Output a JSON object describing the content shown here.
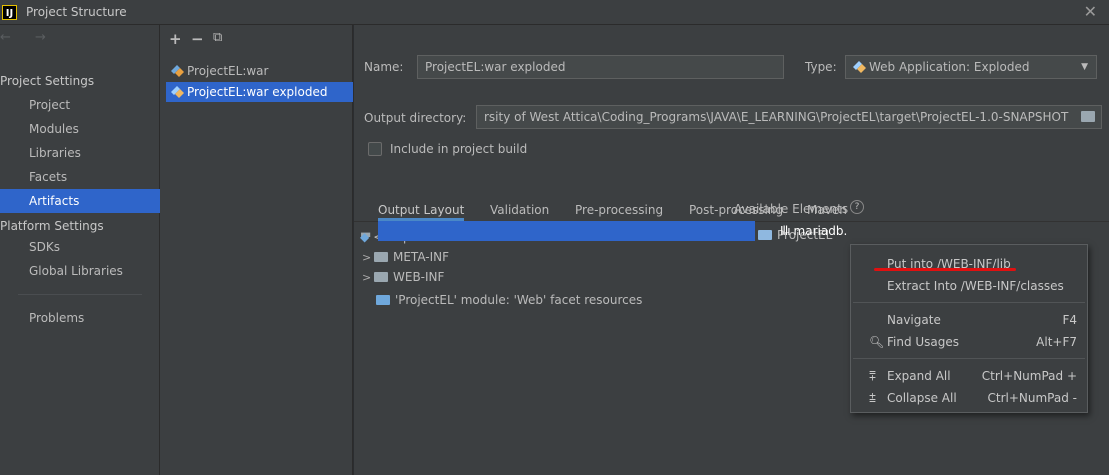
{
  "window": {
    "title": "Project Structure",
    "app_icon_label": "IJ",
    "close_glyph": "✕"
  },
  "nav": {
    "arrows": "← →",
    "project_settings_label": "Project Settings",
    "project_settings_items": [
      "Project",
      "Modules",
      "Libraries",
      "Facets",
      "Artifacts"
    ],
    "selected_item": "Artifacts",
    "platform_settings_label": "Platform Settings",
    "platform_settings_items": [
      "SDKs",
      "Global Libraries"
    ],
    "problems_label": "Problems"
  },
  "artifacts": {
    "toolbar": [
      "+",
      "−",
      "⧉"
    ],
    "items": [
      "ProjectEL:war",
      "ProjectEL:war exploded"
    ],
    "selected": "ProjectEL:war exploded"
  },
  "detail": {
    "name_label": "Name:",
    "name_value": "ProjectEL:war exploded",
    "type_label": "Type:",
    "type_value": "Web Application: Exploded",
    "output_dir_label": "Output directory:",
    "output_dir_value": "rsity of West Attica\\Coding_Programs\\JAVA\\E_LEARNING\\ProjectEL\\target\\ProjectEL-1.0-SNAPSHOT",
    "include_label": "Include in project build",
    "include_checked": false,
    "tabs": [
      "Output Layout",
      "Validation",
      "Pre-processing",
      "Post-processing",
      "Maven"
    ],
    "active_tab": "Output Layout"
  },
  "layout_tree": {
    "items": [
      {
        "label": "<output root>",
        "icon": "output-root-icon"
      },
      {
        "label": "META-INF",
        "icon": "folder-icon"
      },
      {
        "label": "WEB-INF",
        "icon": "folder-icon"
      },
      {
        "label": "'ProjectEL' module: 'Web' facet resources",
        "icon": "web-facet-icon"
      }
    ]
  },
  "available": {
    "label": "Available Elements",
    "help_glyph": "?",
    "project": "ProjectEL",
    "jar_label": "mariadb."
  },
  "context_menu": {
    "put_into": "Put into /WEB-INF/lib",
    "extract_into": "Extract Into /WEB-INF/classes",
    "navigate": "Navigate",
    "navigate_shortcut": "F4",
    "find_usages": "Find Usages",
    "find_usages_shortcut": "Alt+F7",
    "expand_all": "Expand All",
    "expand_all_shortcut": "Ctrl+NumPad +",
    "collapse_all": "Collapse All",
    "collapse_all_shortcut": "Ctrl+NumPad -"
  },
  "colors": {
    "selection": "#2f65ca",
    "panel": "#3c3f41",
    "highlight_underline": "#e01010"
  }
}
